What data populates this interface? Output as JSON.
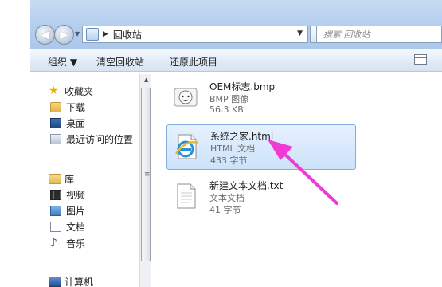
{
  "address": {
    "path": "回收站"
  },
  "search": {
    "placeholder": "搜索 回收站"
  },
  "toolbar": {
    "organize_label": "组织 ▼",
    "empty_label": "清空回收站",
    "restore_label": "还原此项目"
  },
  "sidebar": {
    "favorites_label": "收藏夹",
    "favorites": [
      "下载",
      "桌面",
      "最近访问的位置"
    ],
    "libraries_label": "库",
    "libraries": [
      "视频",
      "图片",
      "文档",
      "音乐"
    ],
    "computer_label": "计算机"
  },
  "files": [
    {
      "name": "OEM标志.bmp",
      "type": "BMP 图像",
      "size": "56.3 KB",
      "icon": "bmp-file-icon"
    },
    {
      "name": "系统之家.html",
      "type": "HTML 文档",
      "size": "433 字节",
      "icon": "ie-html-file-icon",
      "selected": true
    },
    {
      "name": "新建文本文档.txt",
      "type": "文本文档",
      "size": "41 字节",
      "icon": "text-file-icon"
    }
  ],
  "colors": {
    "selection_fill": "#cde2fa",
    "selection_border": "#84acdd",
    "annotation_arrow": "#f03ad6"
  }
}
